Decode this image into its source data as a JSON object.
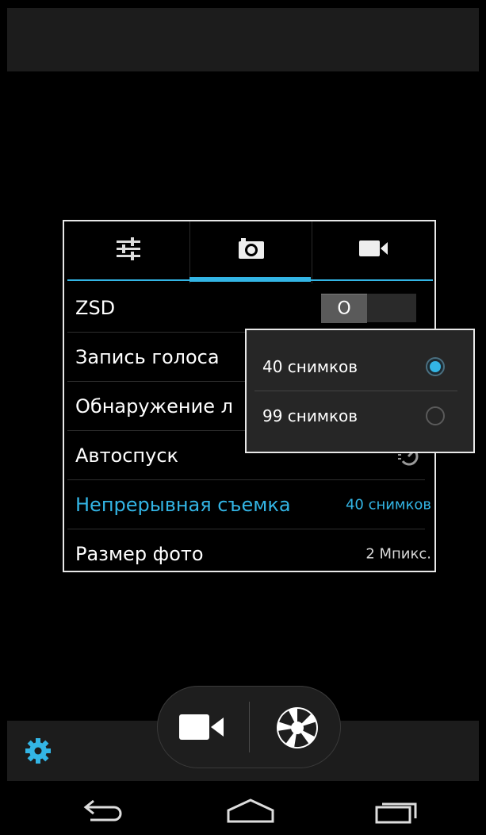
{
  "panel": {
    "tabs": [
      {
        "icon": "sliders-icon",
        "active": false
      },
      {
        "icon": "camera-icon",
        "active": true
      },
      {
        "icon": "video-camera-icon",
        "active": false
      }
    ],
    "rows": [
      {
        "label": "ZSD",
        "toggle_state": "off",
        "toggle_knob": "O"
      },
      {
        "label": "Запись голоса"
      },
      {
        "label": "Обнаружение л"
      },
      {
        "label": "Автоспуск",
        "icon": "timer-icon"
      },
      {
        "label": "Непрерывная съемка",
        "value": "40 снимков",
        "highlighted": true
      },
      {
        "label": "Размер фото",
        "value": "2 Мпикс."
      }
    ]
  },
  "popup": {
    "options": [
      {
        "label": "40 снимков",
        "selected": true
      },
      {
        "label": "99 снимков",
        "selected": false
      }
    ]
  },
  "colors": {
    "accent": "#33b5e5",
    "panel_border": "#e8e8e8",
    "bar": "#1c1c1c"
  },
  "bottom": {
    "settings_icon": "gear-icon",
    "mode_icon": "video-camera-icon",
    "shutter_icon": "shutter-icon"
  },
  "nav": [
    "back-icon",
    "home-icon",
    "recents-icon"
  ]
}
